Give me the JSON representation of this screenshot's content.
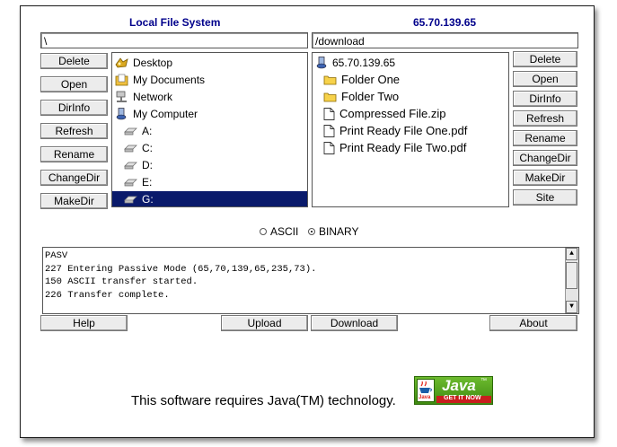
{
  "headers": {
    "local": "Local File System",
    "remote": "65.70.139.65"
  },
  "local": {
    "path": "\\",
    "buttons": [
      "Delete",
      "Open",
      "DirInfo",
      "Refresh",
      "Rename",
      "ChangeDir",
      "MakeDir"
    ],
    "tree": [
      {
        "label": "Desktop",
        "icon": "desktop-icon"
      },
      {
        "label": "My Documents",
        "icon": "my-documents-icon"
      },
      {
        "label": "Network",
        "icon": "network-icon"
      },
      {
        "label": "My Computer",
        "icon": "my-computer-icon"
      },
      {
        "label": "A:",
        "icon": "drive-icon"
      },
      {
        "label": "C:",
        "icon": "drive-icon"
      },
      {
        "label": "D:",
        "icon": "drive-icon"
      },
      {
        "label": "E:",
        "icon": "drive-icon"
      },
      {
        "label": "G:",
        "icon": "drive-icon",
        "selected": true
      }
    ]
  },
  "remote": {
    "path": "/download",
    "buttons": [
      "Delete",
      "Open",
      "DirInfo",
      "Refresh",
      "Rename",
      "ChangeDir",
      "MakeDir",
      "Site"
    ],
    "tree": [
      {
        "label": "65.70.139.65",
        "icon": "server-icon"
      },
      {
        "label": "Folder One",
        "icon": "folder-icon"
      },
      {
        "label": "Folder Two",
        "icon": "folder-icon"
      },
      {
        "label": "Compressed File.zip",
        "icon": "file-icon"
      },
      {
        "label": "Print Ready File One.pdf",
        "icon": "file-icon"
      },
      {
        "label": "Print Ready File Two.pdf",
        "icon": "file-icon"
      }
    ]
  },
  "transfer_mode": {
    "options": [
      "ASCII",
      "BINARY"
    ],
    "selected": "BINARY"
  },
  "log": [
    "PASV",
    "227 Entering Passive Mode (65,70,139,65,235,73).",
    "150 ASCII transfer started.",
    "226 Transfer complete."
  ],
  "bottom_buttons": {
    "help": "Help",
    "upload": "Upload",
    "download": "Download",
    "about": "About"
  },
  "footer": {
    "text": "This software requires Java(TM) technology.",
    "badge_word": "Java",
    "badge_tm": "™",
    "badge_sub": "GET IT NOW",
    "badge_logo": "Java"
  },
  "colors": {
    "header": "#00008b",
    "selection": "#0a1a6b",
    "java_green": "#4a9a1a"
  }
}
